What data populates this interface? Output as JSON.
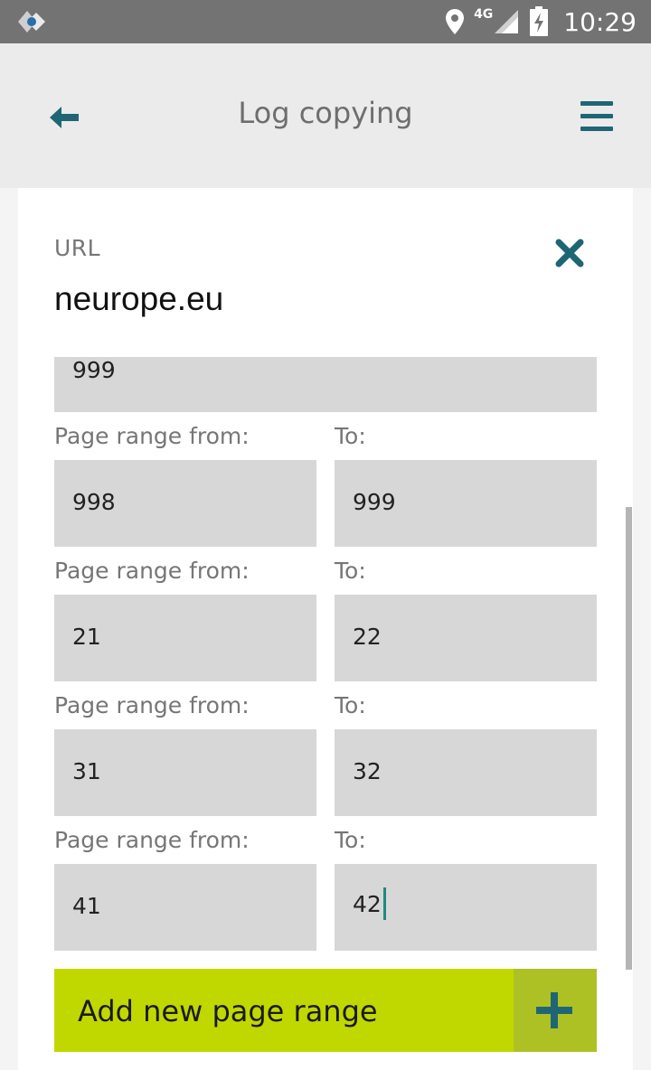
{
  "status_bar": {
    "network": "4G",
    "time": "10:29"
  },
  "app_bar": {
    "title": "Log copying",
    "back_icon": "back-arrow-icon",
    "menu_icon": "hamburger-menu-icon"
  },
  "entry": {
    "url_label": "URL",
    "url_value": "neurope.eu",
    "close_icon": "close-icon"
  },
  "page_ranges": {
    "from_label": "Page range from:",
    "to_label": "To:",
    "partial_top_value": "999",
    "rows": [
      {
        "from": "998",
        "to": "999"
      },
      {
        "from": "21",
        "to": "22"
      },
      {
        "from": "31",
        "to": "32"
      },
      {
        "from": "41",
        "to": "42"
      }
    ]
  },
  "add_button": {
    "label": "Add new page range",
    "icon": "plus-icon"
  },
  "colors": {
    "accent": "#1f6675",
    "add_button": "#c1d700",
    "add_button_icon_bg": "#adc125",
    "field_bg": "#d7d7d7"
  }
}
